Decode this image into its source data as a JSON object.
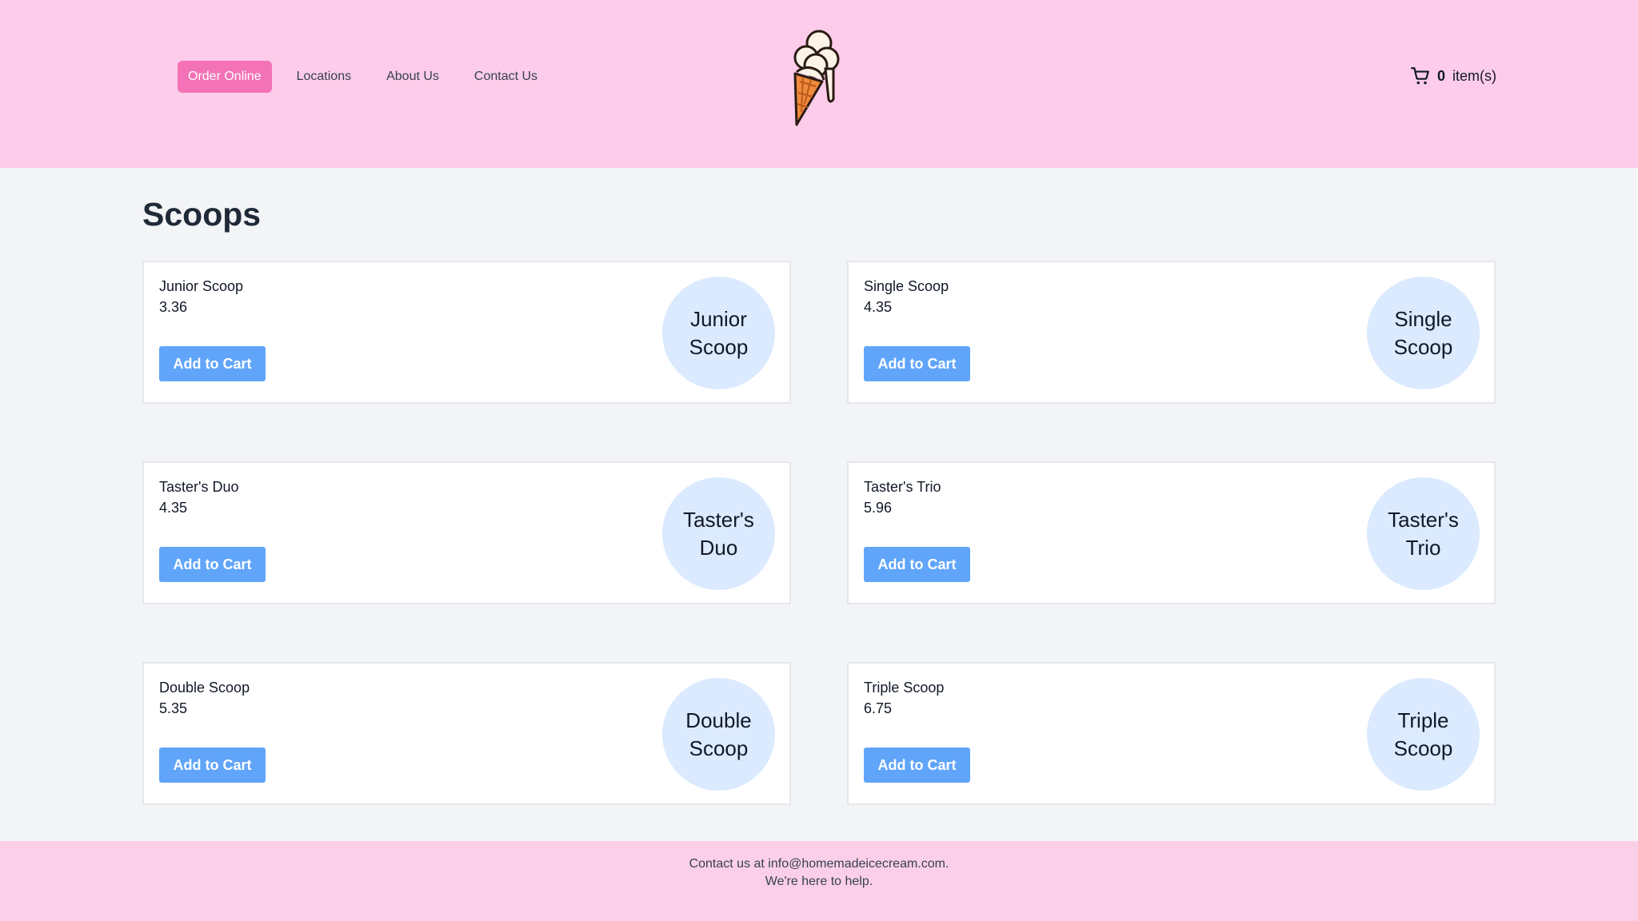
{
  "nav": {
    "items": [
      {
        "label": "Order Online",
        "active": true
      },
      {
        "label": "Locations"
      },
      {
        "label": "About Us"
      },
      {
        "label": "Contact Us"
      }
    ]
  },
  "logo": {
    "icon": "ice-cream-cone-icon"
  },
  "cart": {
    "icon": "shopping-cart-icon",
    "count": "0",
    "label": "item(s)"
  },
  "page": {
    "title": "Scoops"
  },
  "products": [
    {
      "name": "Junior Scoop",
      "price": "3.36",
      "button": "Add to Cart",
      "circle": "Junior Scoop"
    },
    {
      "name": "Single Scoop",
      "price": "4.35",
      "button": "Add to Cart",
      "circle": "Single Scoop"
    },
    {
      "name": "Taster's Duo",
      "price": "4.35",
      "button": "Add to Cart",
      "circle": "Taster's Duo"
    },
    {
      "name": "Taster's Trio",
      "price": "5.96",
      "button": "Add to Cart",
      "circle": "Taster's Trio"
    },
    {
      "name": "Double Scoop",
      "price": "5.35",
      "button": "Add to Cart",
      "circle": "Double Scoop"
    },
    {
      "name": "Triple Scoop",
      "price": "6.75",
      "button": "Add to Cart",
      "circle": "Triple Scoop"
    }
  ],
  "footer": {
    "line1": "Contact us at info@homemadeicecream.com.",
    "line2": "We're here to help."
  },
  "colors": {
    "header_bg": "#fdccea",
    "accent_pink": "#f472b6",
    "button_blue": "#60a5fa",
    "circle_blue": "#dbeafe",
    "page_bg": "#f3f4f6"
  }
}
